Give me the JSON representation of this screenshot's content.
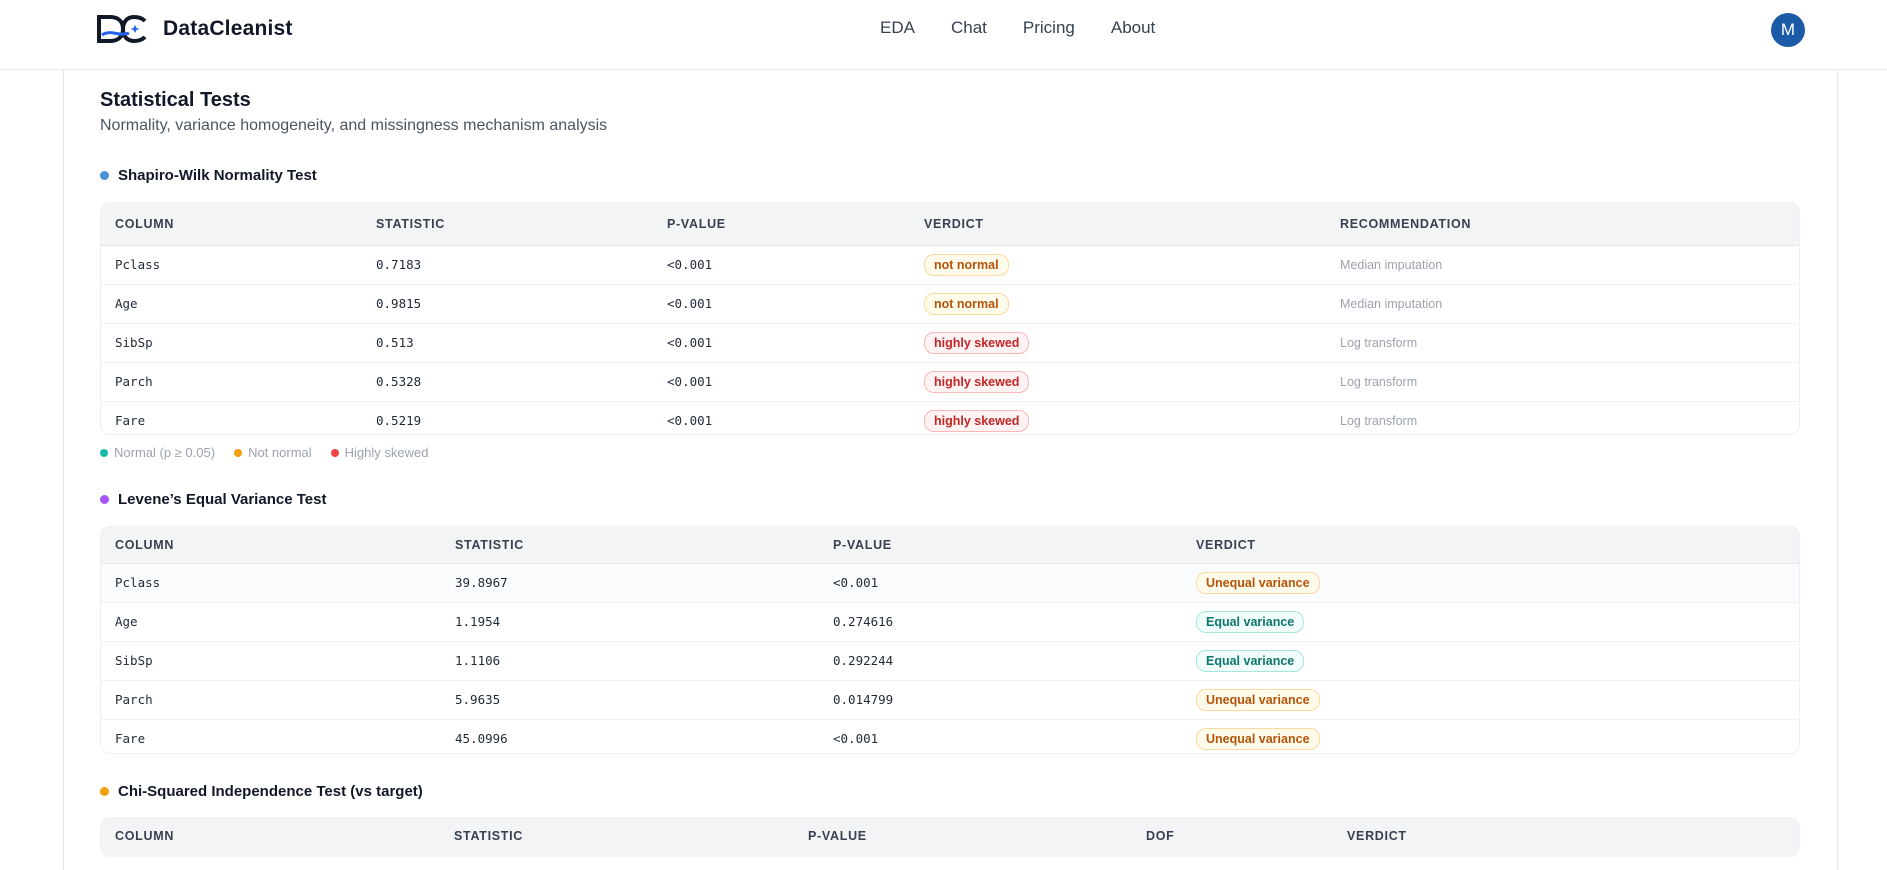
{
  "app": {
    "name": "DataCleanist",
    "avatar_initial": "M"
  },
  "nav": {
    "links": [
      "EDA",
      "Chat",
      "Pricing",
      "About"
    ]
  },
  "section": {
    "title": "Statistical Tests",
    "subtitle": "Normality, variance homogeneity, and missingness mechanism analysis"
  },
  "shapiro": {
    "title": "Shapiro-Wilk Normality Test",
    "dot_color": "#4a90d9",
    "headers": [
      "COLUMN",
      "STATISTIC",
      "P-VALUE",
      "VERDICT",
      "RECOMMENDATION"
    ],
    "rows": [
      {
        "column": "Pclass",
        "statistic": "0.7183",
        "p_value": "<0.001",
        "verdict": "not normal",
        "verdict_kind": "amber",
        "recommendation": "Median imputation"
      },
      {
        "column": "Age",
        "statistic": "0.9815",
        "p_value": "<0.001",
        "verdict": "not normal",
        "verdict_kind": "amber",
        "recommendation": "Median imputation"
      },
      {
        "column": "SibSp",
        "statistic": "0.513",
        "p_value": "<0.001",
        "verdict": "highly skewed",
        "verdict_kind": "red",
        "recommendation": "Log transform"
      },
      {
        "column": "Parch",
        "statistic": "0.5328",
        "p_value": "<0.001",
        "verdict": "highly skewed",
        "verdict_kind": "red",
        "recommendation": "Log transform"
      },
      {
        "column": "Fare",
        "statistic": "0.5219",
        "p_value": "<0.001",
        "verdict": "highly skewed",
        "verdict_kind": "red",
        "recommendation": "Log transform"
      }
    ],
    "legend": [
      {
        "label": "Normal (p ≥ 0.05)",
        "color": "#14b8a6"
      },
      {
        "label": "Not normal",
        "color": "#f59e0b"
      },
      {
        "label": "Highly skewed",
        "color": "#ef4444"
      }
    ]
  },
  "levene": {
    "title": "Levene’s Equal Variance Test",
    "dot_color": "#a855f7",
    "headers": [
      "COLUMN",
      "STATISTIC",
      "P-VALUE",
      "VERDICT"
    ],
    "rows": [
      {
        "column": "Pclass",
        "statistic": "39.8967",
        "p_value": "<0.001",
        "verdict": "Unequal variance",
        "verdict_kind": "amber"
      },
      {
        "column": "Age",
        "statistic": "1.1954",
        "p_value": "0.274616",
        "verdict": "Equal variance",
        "verdict_kind": "green"
      },
      {
        "column": "SibSp",
        "statistic": "1.1106",
        "p_value": "0.292244",
        "verdict": "Equal variance",
        "verdict_kind": "green"
      },
      {
        "column": "Parch",
        "statistic": "5.9635",
        "p_value": "0.014799",
        "verdict": "Unequal variance",
        "verdict_kind": "amber"
      },
      {
        "column": "Fare",
        "statistic": "45.0996",
        "p_value": "<0.001",
        "verdict": "Unequal variance",
        "verdict_kind": "amber"
      }
    ]
  },
  "chi": {
    "title": "Chi-Squared Independence Test (vs target)",
    "dot_color": "#f59e0b",
    "headers": [
      "COLUMN",
      "STATISTIC",
      "P-VALUE",
      "DOF",
      "VERDICT"
    ]
  }
}
